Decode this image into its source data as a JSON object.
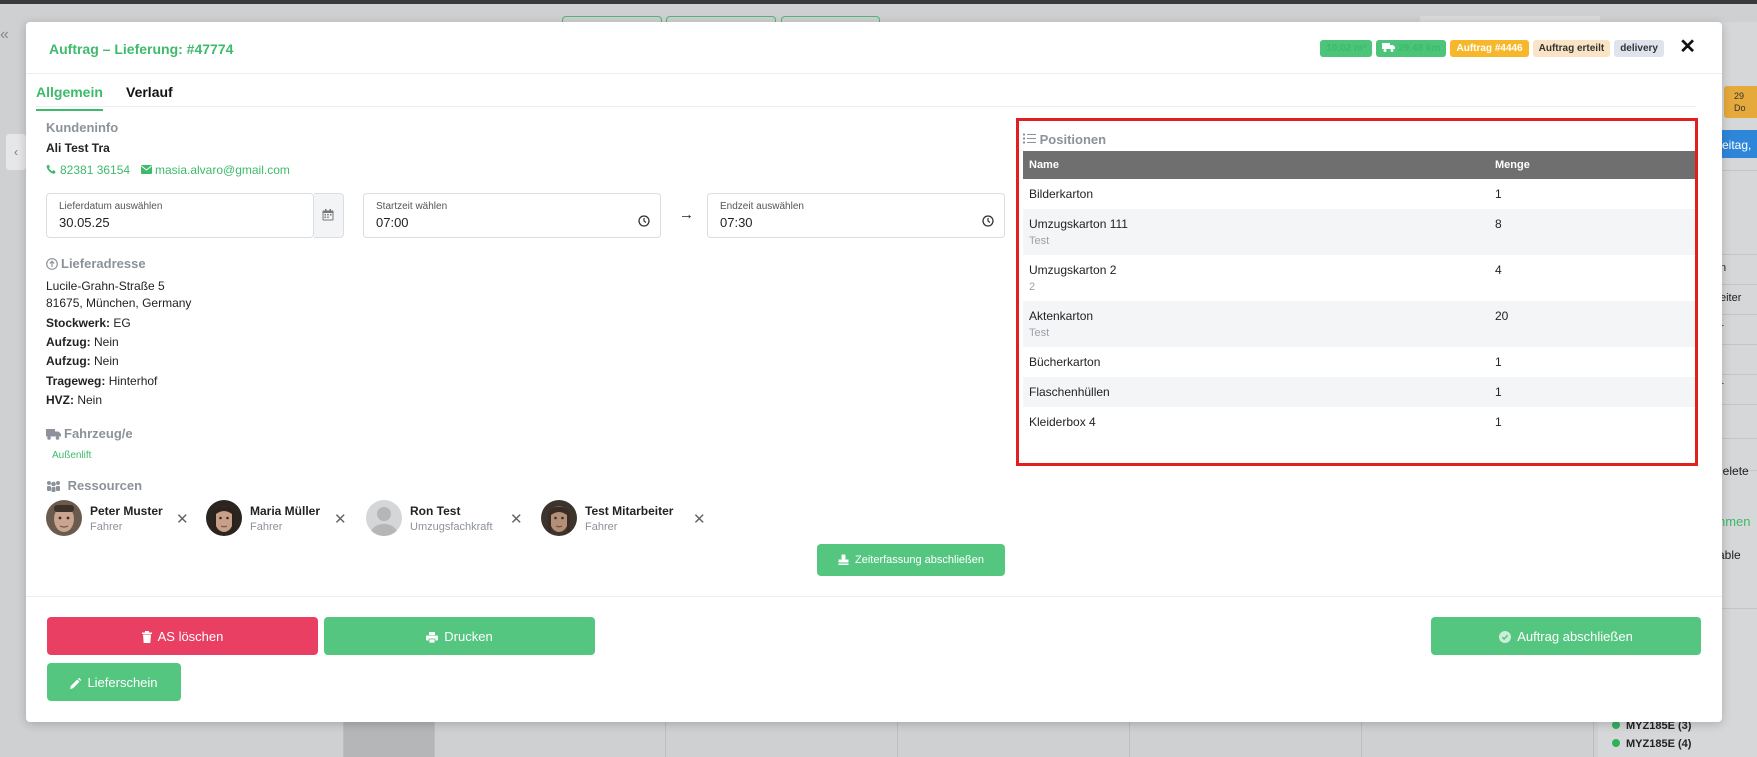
{
  "background": {
    "vehicles": [
      "MYZ185E (3)",
      "MYZ185E (4)"
    ],
    "right_texts": [
      "29",
      "Do",
      "eitag,",
      "n",
      "eiter",
      "r",
      "r",
      "delete",
      "nmen",
      "able"
    ]
  },
  "modal": {
    "title": "Auftrag – Lieferung: #47774",
    "badges": [
      {
        "text": "10.02 m³",
        "style": "green"
      },
      {
        "text": "29.48 km",
        "style": "green",
        "icon": "truck-icon"
      },
      {
        "text": "Auftrag #4446",
        "style": "yellow"
      },
      {
        "text": "Auftrag erteilt",
        "style": "peach"
      },
      {
        "text": "delivery",
        "style": "grey"
      }
    ],
    "close_label": "✕"
  },
  "tabs": [
    {
      "label": "Allgemein",
      "active": true
    },
    {
      "label": "Verlauf",
      "active": false
    }
  ],
  "customer": {
    "heading": "Kundeninfo",
    "name": "Ali Test Tra",
    "phone": "82381 36154",
    "email": "masia.alvaro@gmail.com"
  },
  "schedule": {
    "date_label": "Lieferdatum auswählen",
    "date_value": "30.05.25",
    "start_label": "Startzeit wählen",
    "start_value": "07:00",
    "end_label": "Endzeit auswählen",
    "end_value": "07:30",
    "arrow": "→"
  },
  "address": {
    "heading": "Lieferadresse",
    "street": "Lucile-Grahn-Straße 5",
    "city": "81675, München, Germany",
    "details": [
      {
        "label": "Stockwerk:",
        "value": "EG"
      },
      {
        "label": "Aufzug:",
        "value": "Nein"
      },
      {
        "label": "Aufzug:",
        "value": "Nein"
      },
      {
        "label": "Trageweg:",
        "value": "Hinterhof"
      },
      {
        "label": "HVZ:",
        "value": "Nein"
      }
    ]
  },
  "vehicles": {
    "heading": "Fahrzeug/e",
    "items": [
      "Außenlift"
    ]
  },
  "resources": {
    "heading": "Ressourcen",
    "people": [
      {
        "name": "Peter Muster",
        "role": "Fahrer"
      },
      {
        "name": "Maria Müller",
        "role": "Fahrer"
      },
      {
        "name": "Ron Test",
        "role": "Umzugsfachkraft"
      },
      {
        "name": "Test Mitarbeiter",
        "role": "Fahrer"
      }
    ]
  },
  "actions": {
    "time_tracking": "Zeiterfassung abschließen",
    "delete": "AS löschen",
    "print": "Drucken",
    "complete": "Auftrag abschließen",
    "delivery_note": "Lieferschein"
  },
  "positions": {
    "heading": "Positionen",
    "columns": [
      "Name",
      "Menge"
    ],
    "rows": [
      {
        "name": "Bilderkarton",
        "note": "",
        "qty": "1"
      },
      {
        "name": "Umzugskarton 111",
        "note": "Test",
        "qty": "8"
      },
      {
        "name": "Umzugskarton 2",
        "note": "2",
        "qty": "4"
      },
      {
        "name": "Aktenkarton",
        "note": "Test",
        "qty": "20"
      },
      {
        "name": "Bücherkarton",
        "note": "",
        "qty": "1"
      },
      {
        "name": "Flaschenhüllen",
        "note": "",
        "qty": "1"
      },
      {
        "name": "Kleiderbox 4",
        "note": "",
        "qty": "1"
      }
    ]
  }
}
